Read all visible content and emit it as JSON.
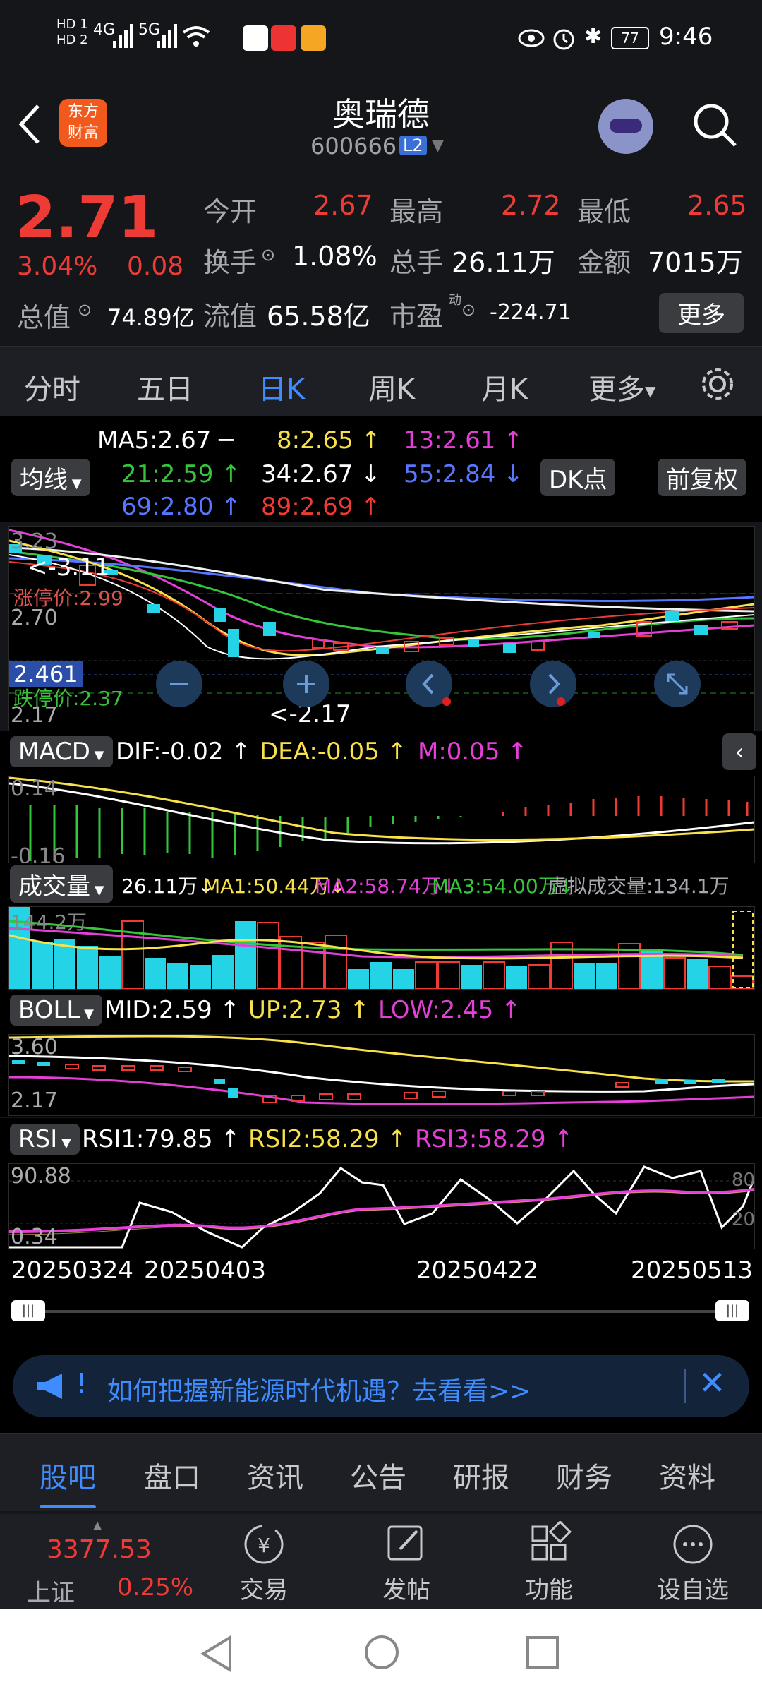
{
  "status": {
    "time": "9:46",
    "battery": "77",
    "sim1": "HD 1",
    "sim2": "HD 2",
    "net1": "4G",
    "net2": "5G"
  },
  "header": {
    "title": "奥瑞德",
    "code": "600666",
    "level": "L2",
    "logo_line1": "东方",
    "logo_line2": "财富"
  },
  "quote": {
    "price": "2.71",
    "pct": "3.04%",
    "change": "0.08",
    "open_label": "今开",
    "open": "2.67",
    "high_label": "最高",
    "high": "2.72",
    "low_label": "最低",
    "low": "2.65",
    "turnover_label": "换手",
    "turnover": "1.08%",
    "volume_label": "总手",
    "volume": "26.11万",
    "amount_label": "金额",
    "amount": "7015万",
    "mktcap_label": "总值",
    "mktcap": "74.89亿",
    "float_label": "流值",
    "float": "65.58亿",
    "pe_label": "市盈",
    "pe_sup": "动",
    "pe": "-224.71",
    "more": "更多"
  },
  "tabs": [
    "分时",
    "五日",
    "日K",
    "周K",
    "月K",
    "更多"
  ],
  "ma": {
    "selector": "均线",
    "ma5": "MA5:2.67 ─",
    "ma8": "8:2.65 ↑",
    "ma13": "13:2.61 ↑",
    "ma21": "21:2.59 ↑",
    "ma34": "34:2.67 ↓",
    "ma55": "55:2.84 ↓",
    "ma69": "69:2.80 ↑",
    "ma89": "89:2.69 ↑",
    "dk": "DK点",
    "fq": "前复权"
  },
  "kline": {
    "y_top": "3.23",
    "y_mid": "2.70",
    "y_bot": "2.17",
    "max_label": "<-3.11",
    "min_label": "<-2.17",
    "limit_up": "涨停价:2.99",
    "limit_down": "跌停价:2.37",
    "price_tag": "2.461"
  },
  "macd": {
    "selector": "MACD",
    "dif": "DIF:-0.02 ↑",
    "dea": "DEA:-0.05 ↑",
    "m": "M:0.05 ↑",
    "y_top": "0.14",
    "y_bot": "-0.16"
  },
  "vol": {
    "selector": "成交量",
    "v": "26.11万↓",
    "ma1": "MA1:50.44万↓",
    "ma2": "MA2:58.74万↓",
    "ma3": "MA3:54.00万↓",
    "virtual": "虚拟成交量:134.1万",
    "y_top": "144.2万"
  },
  "boll": {
    "selector": "BOLL",
    "mid": "MID:2.59 ↑",
    "up": "UP:2.73 ↑",
    "low": "LOW:2.45 ↑",
    "y_top": "3.60",
    "y_bot": "2.17"
  },
  "rsi": {
    "selector": "RSI",
    "r1": "RSI1:79.85 ↑",
    "r2": "RSI2:58.29 ↑",
    "r3": "RSI3:58.29 ↑",
    "y_top": "90.88",
    "y_bot": "0.34",
    "r80": "80",
    "r20": "20"
  },
  "dates": [
    "20250324",
    "20250403",
    "20250422",
    "20250513"
  ],
  "banner": {
    "text": "如何把握新能源时代机遇？去看看>>"
  },
  "bottom_tabs": [
    "股吧",
    "盘口",
    "资讯",
    "公告",
    "研报",
    "财务",
    "资料"
  ],
  "toolbar": {
    "index_value": "3377.53",
    "index_name": "上证",
    "index_pct": "0.25%",
    "trade": "交易",
    "post": "发帖",
    "func": "功能",
    "fav": "设自选"
  },
  "colors": {
    "up": "#ef3b36",
    "down": "#24d3e6",
    "accent": "#3f8cff",
    "bg": "#15161a"
  }
}
